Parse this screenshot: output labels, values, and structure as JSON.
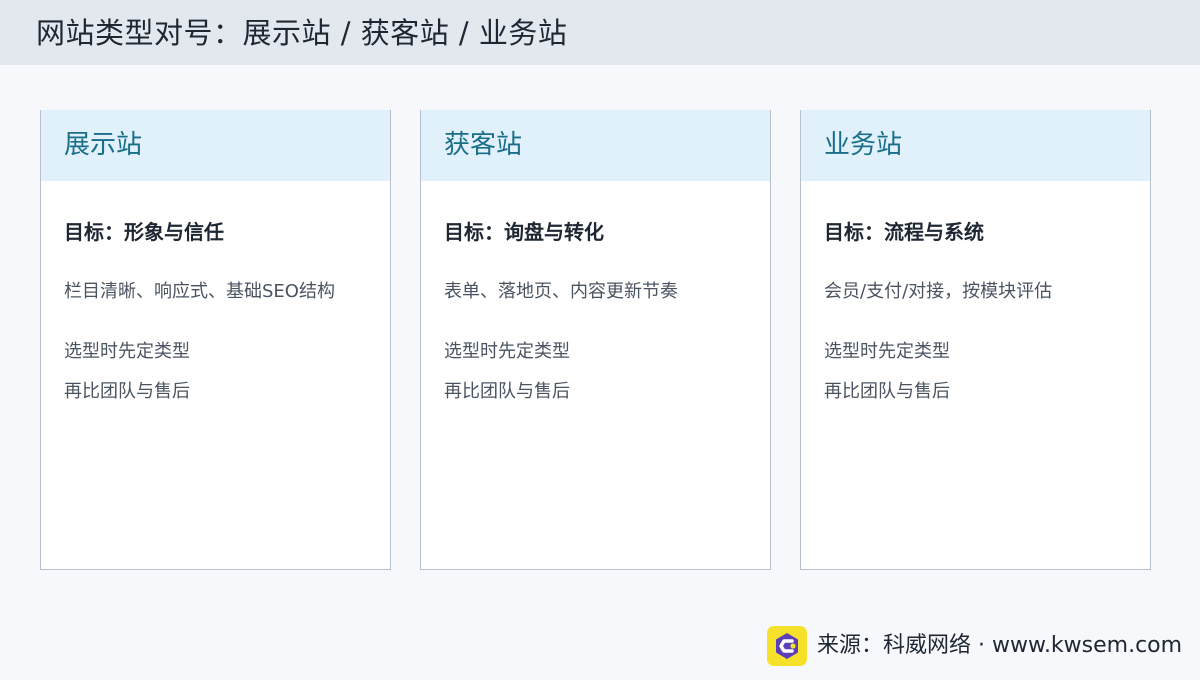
{
  "header": {
    "title": "网站类型对号：展示站 / 获客站 / 业务站"
  },
  "cards": [
    {
      "title": "展示站",
      "goal": "目标：形象与信任",
      "detail": "栏目清晰、响应式、基础SEO结构",
      "notes": [
        "选型时先定类型",
        "再比团队与售后"
      ]
    },
    {
      "title": "获客站",
      "goal": "目标：询盘与转化",
      "detail": "表单、落地页、内容更新节奏",
      "notes": [
        "选型时先定类型",
        "再比团队与售后"
      ]
    },
    {
      "title": "业务站",
      "goal": "目标：流程与系统",
      "detail": "会员/支付/对接，按模块评估",
      "notes": [
        "选型时先定类型",
        "再比团队与售后"
      ]
    }
  ],
  "footer": {
    "source": "来源：科威网络 · www.kwsem.com",
    "logo_icon": "kwsem-logo-icon"
  },
  "colors": {
    "header_bg": "#e3e8ef",
    "card_header_bg": "#e0f1fc",
    "card_title": "#1a6e88",
    "logo_bg": "#f6e12a",
    "logo_mark": "#5b3fb8"
  }
}
